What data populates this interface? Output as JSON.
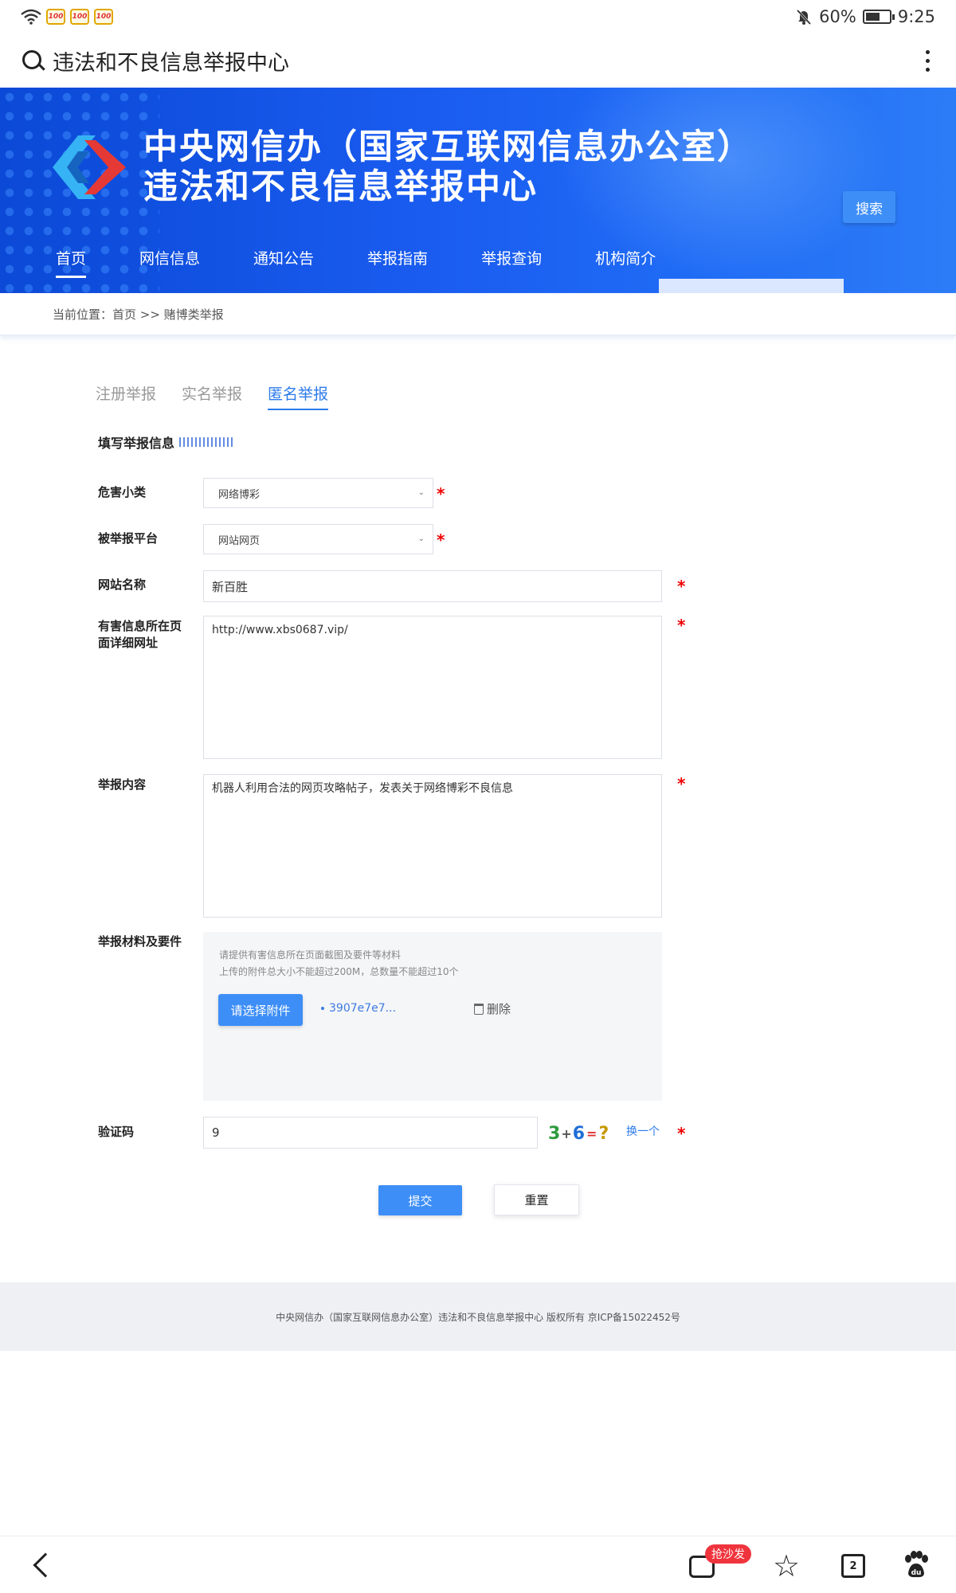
{
  "status_bar": {
    "app_badges": [
      "100",
      "100",
      "100"
    ],
    "battery": "60%",
    "battery_level": 0.6,
    "time": "9:25"
  },
  "browser": {
    "title": "违法和不良信息举报中心"
  },
  "banner": {
    "title_line1": "中央网信办（国家互联网信息办公室）",
    "title_line2": "违法和不良信息举报中心",
    "nav": [
      "首页",
      "网信信息",
      "通知公告",
      "举报指南",
      "举报查询",
      "机构简介"
    ],
    "search_button": "搜索"
  },
  "breadcrumb": "当前位置：首页 >> 赌博类举报",
  "tabs": [
    "注册举报",
    "实名举报",
    "匿名举报"
  ],
  "section_title": "填写举报信息",
  "form": {
    "harm_subcategory_label": "危害小类",
    "harm_subcategory_value": "网络博彩",
    "platform_label": "被举报平台",
    "platform_value": "网站网页",
    "site_name_label": "网站名称",
    "site_name_value": "新百胜",
    "url_label": "有害信息所在页面详细网址",
    "url_value": "http://www.xbs0687.vip/",
    "content_label": "举报内容",
    "content_value": "机器人利用合法的网页攻略帖子，发表关于网络博彩不良信息",
    "materials_label": "举报材料及要件",
    "upload_hint1": "请提供有害信息所在页面截图及要件等材料",
    "upload_hint2": "上传的附件总大小不能超过200M，总数量不能超过10个",
    "upload_button": "请选择附件",
    "file_name": "3907e7e7...",
    "delete_label": "删除",
    "captcha_label": "验证码",
    "captcha_value": "9",
    "captcha_chars": [
      "3",
      "+",
      "6",
      "=",
      "?"
    ],
    "refresh_label": "换一个",
    "required_mark": "*",
    "submit": "提交",
    "reset": "重置"
  },
  "footer": "中央网信办（国家互联网信息办公室）违法和不良信息举报中心 版权所有 京ICP备15022452号",
  "bottom_bar": {
    "sofa_badge": "抢沙发",
    "tab_count": "2"
  }
}
